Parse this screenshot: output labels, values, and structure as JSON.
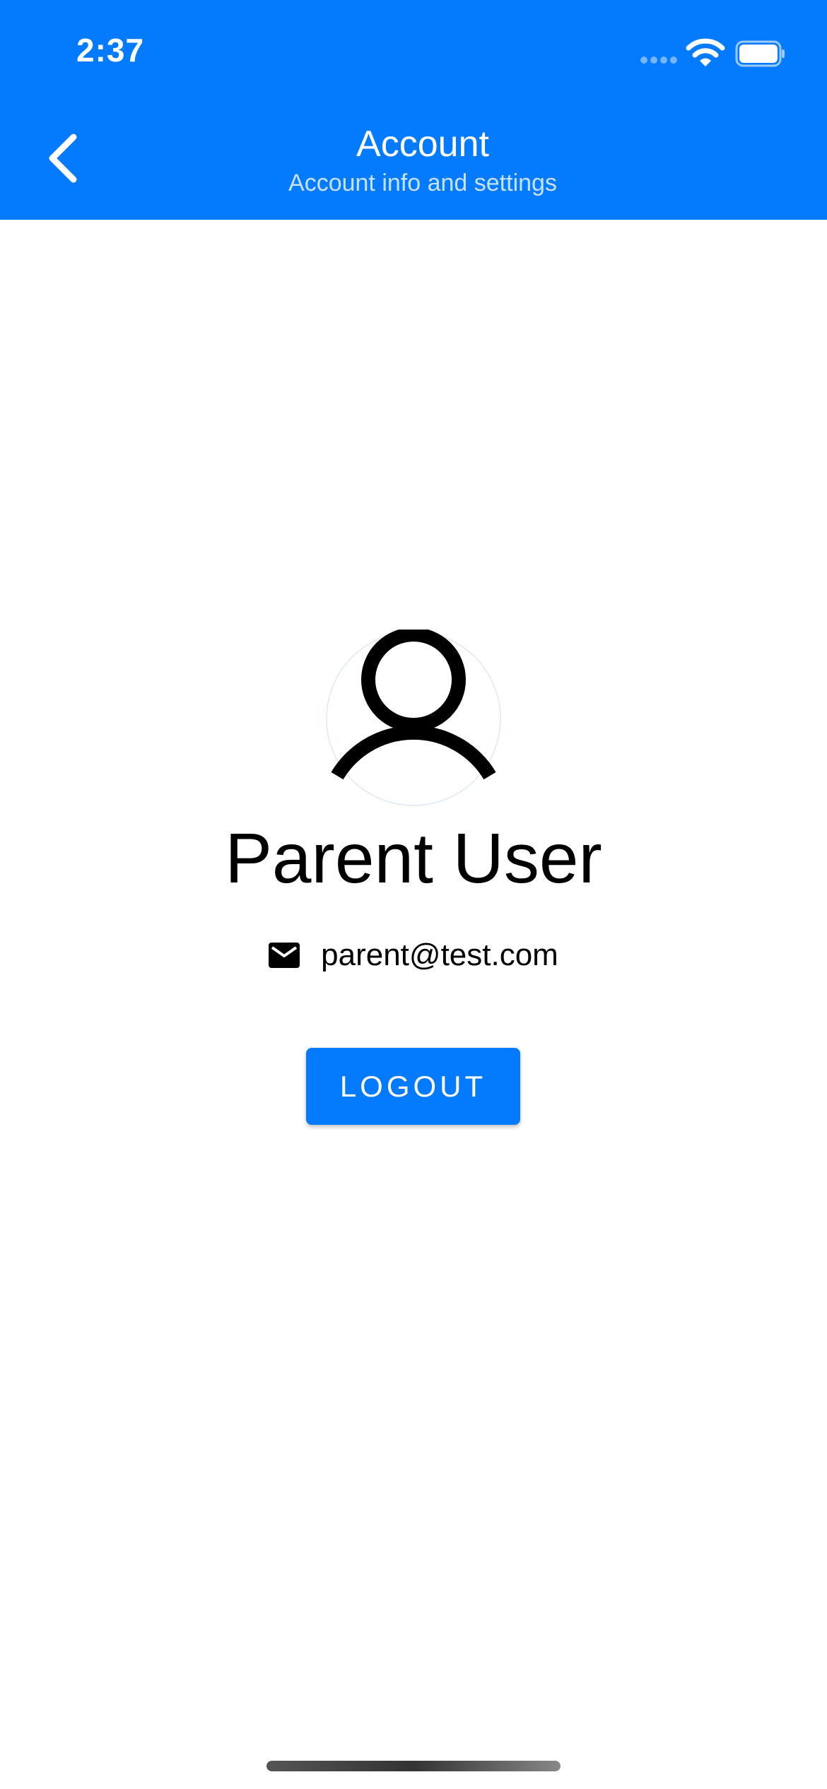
{
  "status_bar": {
    "time": "2:37"
  },
  "header": {
    "title": "Account",
    "subtitle": "Account info and settings",
    "back_icon": "chevron-left-icon"
  },
  "profile": {
    "avatar_icon": "user-icon",
    "name": "Parent User",
    "email_icon": "mail-icon",
    "email": "parent@test.com"
  },
  "actions": {
    "logout_label": "LOGOUT"
  },
  "colors": {
    "primary": "#047aff",
    "header_text": "#ffffff",
    "body_text": "#000000",
    "background": "#ffffff"
  }
}
